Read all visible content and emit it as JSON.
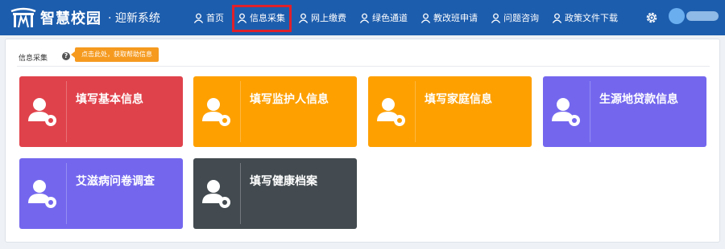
{
  "header": {
    "logo_text": "智慧校园",
    "logo_sub": "· 迎新系统",
    "nav": [
      {
        "label": "首页"
      },
      {
        "label": "信息采集"
      },
      {
        "label": "网上缴费"
      },
      {
        "label": "绿色通道"
      },
      {
        "label": "教改班申请"
      },
      {
        "label": "问题咨询"
      },
      {
        "label": "政策文件下载"
      }
    ],
    "active_index": 1
  },
  "panel": {
    "title": "信息采集",
    "tip": "点击此处，获取帮助信息"
  },
  "cards": [
    {
      "label": "填写基本信息",
      "color": "#e0424b",
      "icon": "user-gear-icon"
    },
    {
      "label": "填写监护人信息",
      "color": "#fea000",
      "icon": "user-gear-icon"
    },
    {
      "label": "填写家庭信息",
      "color": "#fea000",
      "icon": "user-gear-icon"
    },
    {
      "label": "生源地贷款信息",
      "color": "#7467ee",
      "icon": "user-gear-icon"
    },
    {
      "label": "艾滋病问卷调查",
      "color": "#7467ee",
      "icon": "user-gear-icon"
    },
    {
      "label": "填写健康档案",
      "color": "#434b50",
      "icon": "user-gear-icon"
    }
  ],
  "colors": {
    "header_bg": "#1d5dad",
    "highlight": "#e0202a"
  }
}
